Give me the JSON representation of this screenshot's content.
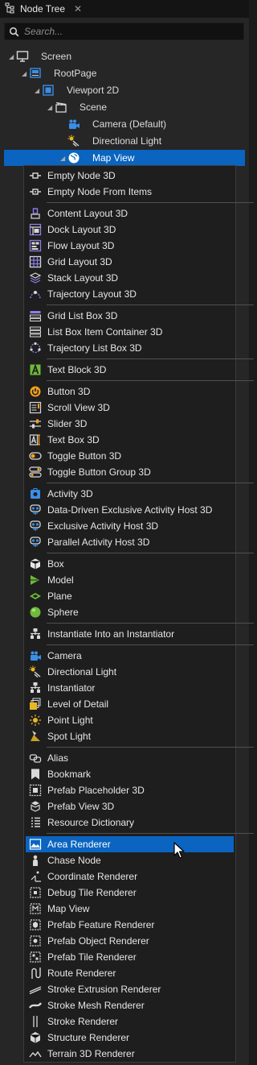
{
  "tab": {
    "title": "Node Tree",
    "close": "✕"
  },
  "search": {
    "placeholder": "Search..."
  },
  "tree": [
    {
      "label": "Screen",
      "icon": "monitor-icon"
    },
    {
      "label": "RootPage",
      "icon": "page-icon"
    },
    {
      "label": "Viewport 2D",
      "icon": "viewport-icon"
    },
    {
      "label": "Scene",
      "icon": "scene-icon"
    },
    {
      "label": "Camera (Default)",
      "icon": "camera-icon"
    },
    {
      "label": "Directional Light",
      "icon": "directional-light-icon"
    },
    {
      "label": "Map View",
      "icon": "globe-icon",
      "selected": true
    }
  ],
  "menu": [
    {
      "label": "Empty Node 3D",
      "icon": "empty-node-icon"
    },
    {
      "label": "Empty Node From Items",
      "icon": "empty-node-items-icon"
    },
    {
      "label": "Content Layout 3D",
      "icon": "content-layout-icon"
    },
    {
      "label": "Dock Layout 3D",
      "icon": "dock-layout-icon"
    },
    {
      "label": "Flow Layout 3D",
      "icon": "flow-layout-icon"
    },
    {
      "label": "Grid Layout 3D",
      "icon": "grid-layout-icon"
    },
    {
      "label": "Stack Layout 3D",
      "icon": "stack-layout-icon"
    },
    {
      "label": "Trajectory Layout 3D",
      "icon": "trajectory-layout-icon"
    },
    {
      "label": "Grid List Box 3D",
      "icon": "grid-list-box-icon"
    },
    {
      "label": "List Box Item Container 3D",
      "icon": "list-box-item-icon"
    },
    {
      "label": "Trajectory List Box 3D",
      "icon": "trajectory-list-box-icon"
    },
    {
      "label": "Text Block 3D",
      "icon": "text-block-icon"
    },
    {
      "label": "Button 3D",
      "icon": "button-icon"
    },
    {
      "label": "Scroll View 3D",
      "icon": "scroll-view-icon"
    },
    {
      "label": "Slider 3D",
      "icon": "slider-icon"
    },
    {
      "label": "Text Box 3D",
      "icon": "text-box-icon"
    },
    {
      "label": "Toggle Button 3D",
      "icon": "toggle-button-icon"
    },
    {
      "label": "Toggle Button Group 3D",
      "icon": "toggle-group-icon"
    },
    {
      "label": "Activity 3D",
      "icon": "activity-icon"
    },
    {
      "label": "Data-Driven Exclusive Activity Host 3D",
      "icon": "activity-host-icon"
    },
    {
      "label": "Exclusive Activity Host 3D",
      "icon": "activity-host-icon"
    },
    {
      "label": "Parallel Activity Host 3D",
      "icon": "activity-host-icon"
    },
    {
      "label": "Box",
      "icon": "box-icon"
    },
    {
      "label": "Model",
      "icon": "model-icon"
    },
    {
      "label": "Plane",
      "icon": "plane-icon"
    },
    {
      "label": "Sphere",
      "icon": "sphere-icon"
    },
    {
      "label": "Instantiate Into an Instantiator",
      "icon": "instantiator-icon"
    },
    {
      "label": "Camera",
      "icon": "camera-icon"
    },
    {
      "label": "Directional Light",
      "icon": "directional-light-icon"
    },
    {
      "label": "Instantiator",
      "icon": "instantiator-icon"
    },
    {
      "label": "Level of Detail",
      "icon": "level-of-detail-icon"
    },
    {
      "label": "Point Light",
      "icon": "point-light-icon"
    },
    {
      "label": "Spot Light",
      "icon": "spot-light-icon"
    },
    {
      "label": "Alias",
      "icon": "alias-icon"
    },
    {
      "label": "Bookmark",
      "icon": "bookmark-icon"
    },
    {
      "label": "Prefab Placeholder 3D",
      "icon": "prefab-placeholder-icon"
    },
    {
      "label": "Prefab View 3D",
      "icon": "prefab-view-icon"
    },
    {
      "label": "Resource Dictionary",
      "icon": "resource-dictionary-icon"
    },
    {
      "label": "Area Renderer",
      "icon": "area-renderer-icon",
      "highlighted": true
    },
    {
      "label": "Chase Node",
      "icon": "chase-node-icon"
    },
    {
      "label": "Coordinate Renderer",
      "icon": "coordinate-renderer-icon"
    },
    {
      "label": "Debug Tile Renderer",
      "icon": "debug-tile-renderer-icon"
    },
    {
      "label": "Map View",
      "icon": "map-view-icon"
    },
    {
      "label": "Prefab Feature Renderer",
      "icon": "prefab-feature-renderer-icon"
    },
    {
      "label": "Prefab Object Renderer",
      "icon": "prefab-object-renderer-icon"
    },
    {
      "label": "Prefab Tile Renderer",
      "icon": "prefab-tile-renderer-icon"
    },
    {
      "label": "Route Renderer",
      "icon": "route-renderer-icon"
    },
    {
      "label": "Stroke Extrusion Renderer",
      "icon": "stroke-extrusion-renderer-icon"
    },
    {
      "label": "Stroke Mesh Renderer",
      "icon": "stroke-mesh-renderer-icon"
    },
    {
      "label": "Stroke Renderer",
      "icon": "stroke-renderer-icon"
    },
    {
      "label": "Structure Renderer",
      "icon": "structure-renderer-icon"
    },
    {
      "label": "Terrain 3D Renderer",
      "icon": "terrain-renderer-icon"
    }
  ],
  "colors": {
    "selection": "#0a64c0",
    "accent_blue": "#3a8ee6",
    "accent_yellow": "#e8b820",
    "accent_green": "#6dbb3a",
    "accent_orange": "#f0a020"
  }
}
